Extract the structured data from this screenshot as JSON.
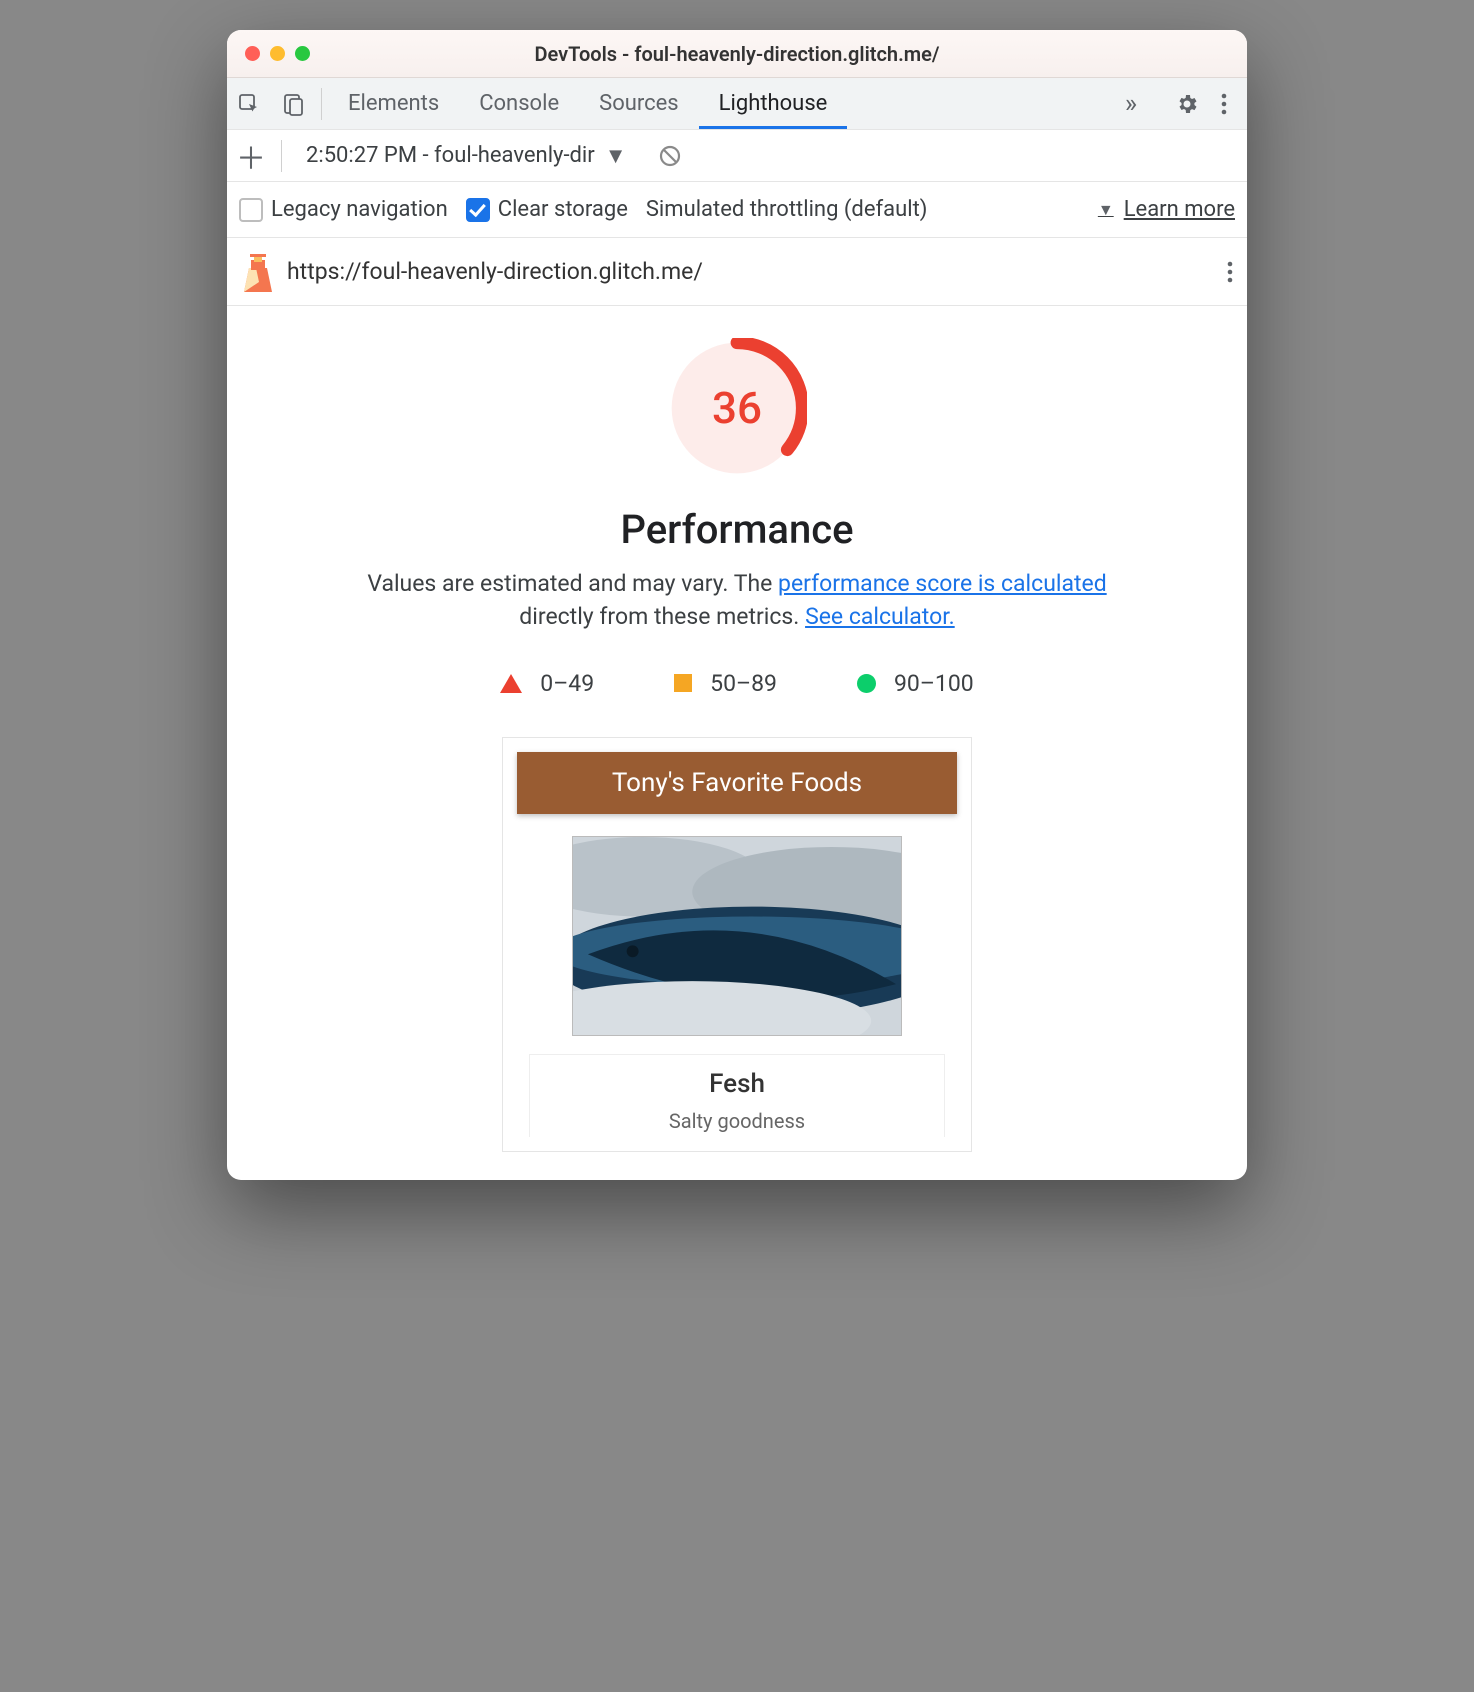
{
  "window": {
    "title": "DevTools - foul-heavenly-direction.glitch.me/"
  },
  "tabs": {
    "items": [
      "Elements",
      "Console",
      "Sources",
      "Lighthouse"
    ],
    "active_index": 3
  },
  "subtoolbar": {
    "report_label": "2:50:27 PM - foul-heavenly-dir"
  },
  "options": {
    "legacy_nav": {
      "label": "Legacy navigation",
      "checked": false
    },
    "clear_storage": {
      "label": "Clear storage",
      "checked": true
    },
    "throttling": "Simulated throttling (default)",
    "learn_more": "Learn more"
  },
  "report": {
    "url": "https://foul-heavenly-direction.glitch.me/",
    "score": "36",
    "score_frac": 0.36,
    "category": "Performance",
    "desc_prefix": "Values are estimated and may vary. The ",
    "desc_link1": "performance score is calculated",
    "desc_mid": " directly from these metrics. ",
    "desc_link2": "See calculator."
  },
  "legend": {
    "fail": "0–49",
    "warn": "50–89",
    "pass": "90–100"
  },
  "preview": {
    "title": "Tony's Favorite Foods",
    "card_name": "Fesh",
    "card_sub": "Salty goodness"
  }
}
